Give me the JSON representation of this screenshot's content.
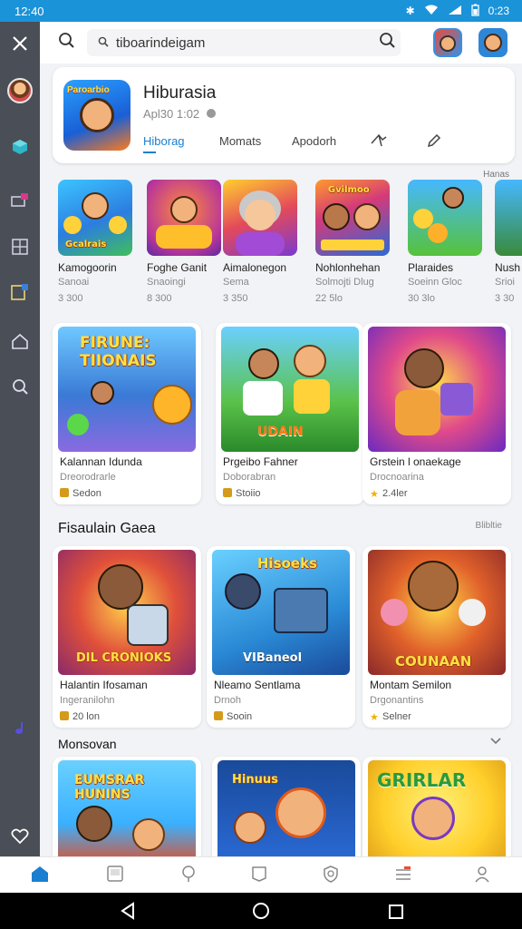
{
  "status_bar": {
    "time": "12:40",
    "right_time": "0:23"
  },
  "search": {
    "value": "tiboarindeigam"
  },
  "app": {
    "title": "Hiburasia",
    "subtitle": "Apl30 1:02",
    "logo_text": "Paroarbio",
    "tabs": [
      "Hiborag",
      "Momats",
      "Apodorh"
    ]
  },
  "small_label": "Hanas",
  "row1": [
    {
      "title": "Kamogoorin",
      "sub": "Sanoai",
      "meta": "3 300",
      "art_text": "Gcalrais"
    },
    {
      "title": "Foghe Ganit",
      "sub": "Snaoingi",
      "meta": "8 300",
      "art_text": ""
    },
    {
      "title": "Aimalonegon",
      "sub": "Sema",
      "meta": "3 350",
      "art_text": ""
    },
    {
      "title": "Nohlonhehan",
      "sub": "Solmojti Dlug",
      "meta": "22 5lo",
      "art_text": "Gvilmoo"
    },
    {
      "title": "Plaraides",
      "sub": "Soeinn Gloc",
      "meta": "30 3lo",
      "art_text": ""
    },
    {
      "title": "Nush",
      "sub": "Srioi",
      "meta": "3 30",
      "art_text": ""
    }
  ],
  "row2": [
    {
      "title": "Kalannan Idunda",
      "sub": "Dreorodrarle",
      "meta": "Sedon",
      "art_text": "FIRUNE: TIIONAIS"
    },
    {
      "title": "Prgeibo Fahner",
      "sub": "Doborabran",
      "meta": "Stoiio",
      "art_text": "UDAIN"
    },
    {
      "title": "Grstein l onaekage",
      "sub": "Drocnoarina",
      "meta": "2.4ler",
      "art_text": ""
    }
  ],
  "section1": {
    "title": "Fisaulain Gaea",
    "more": "Blibltie"
  },
  "row3": [
    {
      "title": "Halantin Ifosaman",
      "sub": "Ingeranilohn",
      "meta": "20 lon",
      "art_text": "DIL CRONIOKS"
    },
    {
      "title": "Nleamo Sentlama",
      "sub": "Drnoh",
      "meta": "Sooin",
      "art_text": "VIBaneol"
    },
    {
      "title": "Montam Semilon",
      "sub": "Drgonantins",
      "meta": "Selner",
      "art_text": "COUNAAN"
    }
  ],
  "section2": {
    "title": "Monsovan"
  },
  "row4": [
    {
      "art_text": "EUMSRAR HUNINS"
    },
    {
      "art_text": "Hinuus"
    },
    {
      "art_text": "GRIRLAR"
    }
  ],
  "colors": {
    "accent": "#1a7fd0",
    "status_bar": "#1b93d8",
    "sidebar": "#4a4e56"
  },
  "icons": {
    "sidebar": [
      "close-icon",
      "avatar",
      "cube-icon",
      "media-icon",
      "grid-icon",
      "book-icon",
      "house-icon",
      "search-icon",
      "note-icon",
      "heart-icon"
    ],
    "bottom_nav": [
      "home-icon",
      "apps-icon",
      "location-icon",
      "bookmark-icon",
      "shield-icon",
      "menu-icon",
      "person-icon"
    ]
  }
}
